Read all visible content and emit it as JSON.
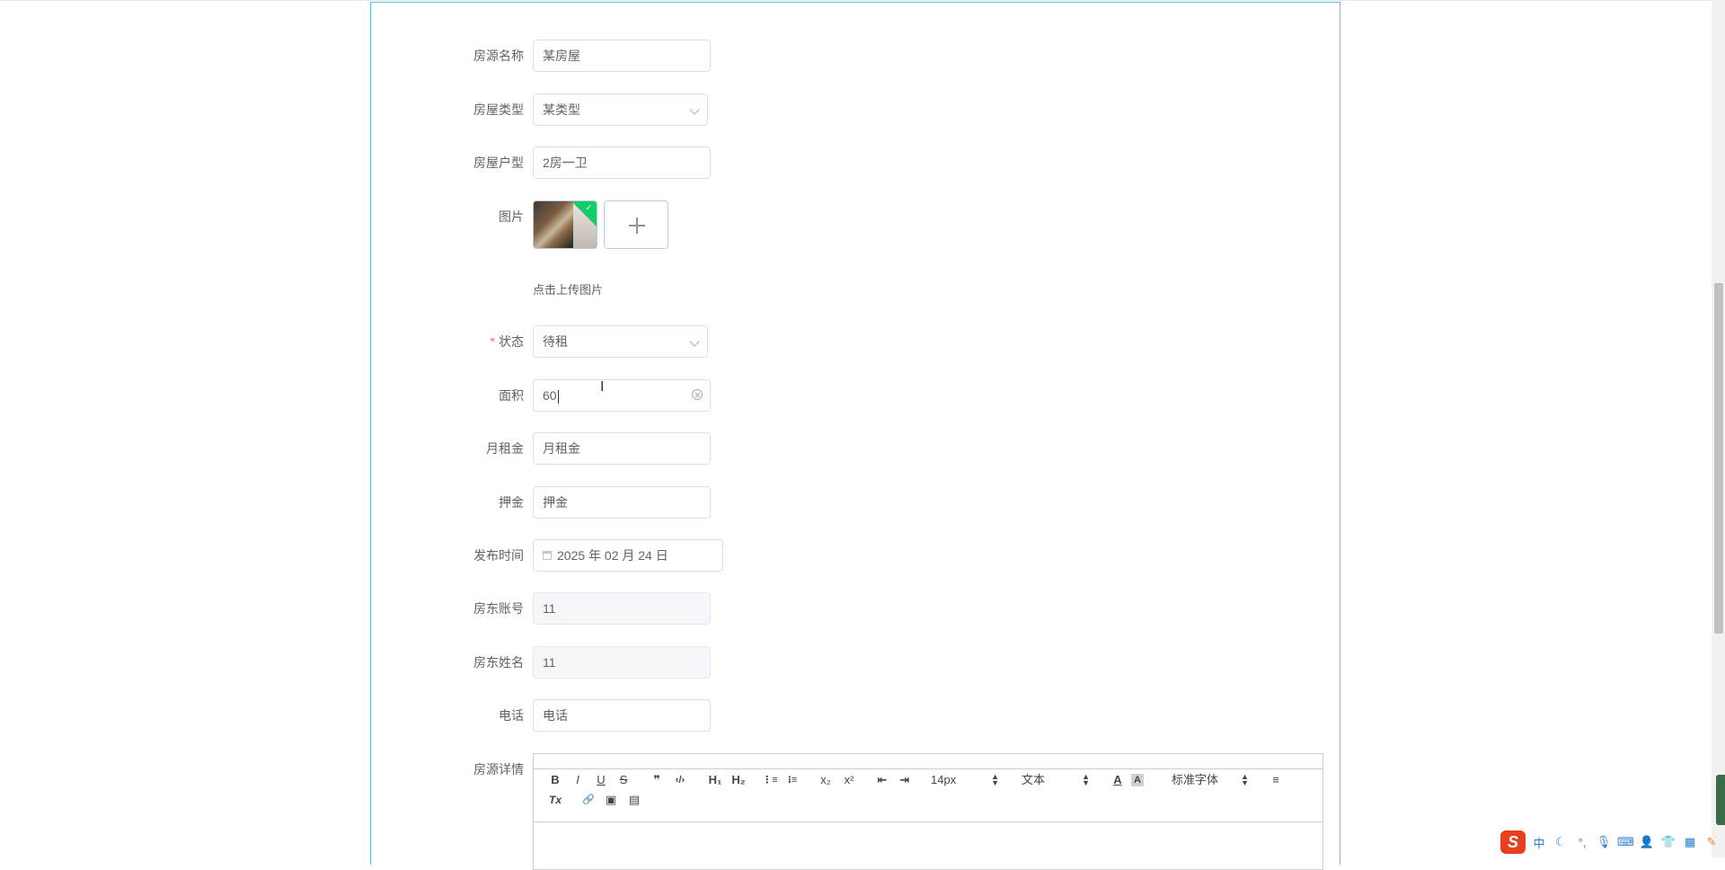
{
  "form": {
    "title_name": {
      "label": "房源名称",
      "value": "某房屋"
    },
    "house_type": {
      "label": "房屋类型",
      "value": "某类型"
    },
    "layout": {
      "label": "房屋户型",
      "value": "2房一卫"
    },
    "image": {
      "label": "图片",
      "tip": "点击上传图片"
    },
    "status": {
      "required_mark": "*",
      "label": "状态",
      "value": "待租"
    },
    "area": {
      "label": "面积",
      "value": "60"
    },
    "rent": {
      "label": "月租金",
      "placeholder": "月租金"
    },
    "deposit": {
      "label": "押金",
      "placeholder": "押金"
    },
    "publish_time": {
      "label": "发布时间",
      "value": "2025 年 02 月 24 日"
    },
    "landlord_account": {
      "label": "房东账号",
      "value": "11"
    },
    "landlord_name": {
      "label": "房东姓名",
      "value": "11"
    },
    "phone": {
      "label": "电话",
      "placeholder": "电话"
    },
    "details": {
      "label": "房源详情"
    }
  },
  "editor_toolbar": {
    "bold": "B",
    "italic": "I",
    "underline": "U",
    "strike": "S",
    "quote": "❞",
    "code": "‹/›",
    "h1": "H₁",
    "h2": "H₂",
    "ordered_list": "⋮≡",
    "bullet_list": "⁝≡",
    "subscript": "x₂",
    "superscript": "x²",
    "outdent": "⇤",
    "indent": "⇥",
    "size": "14px",
    "format": "文本",
    "font": "标准字体",
    "font_color": "A",
    "bg_color": "A",
    "align": "≡",
    "clean": "Tx",
    "link": "🔗",
    "image": "▣",
    "video": "▤"
  },
  "ime": {
    "logo": "S",
    "lang": "中"
  },
  "colors": {
    "frame_border": "#5cc3d6",
    "required": "#f56c6c",
    "upload_success": "#13ce66",
    "ime_logo": "#e8401c"
  }
}
